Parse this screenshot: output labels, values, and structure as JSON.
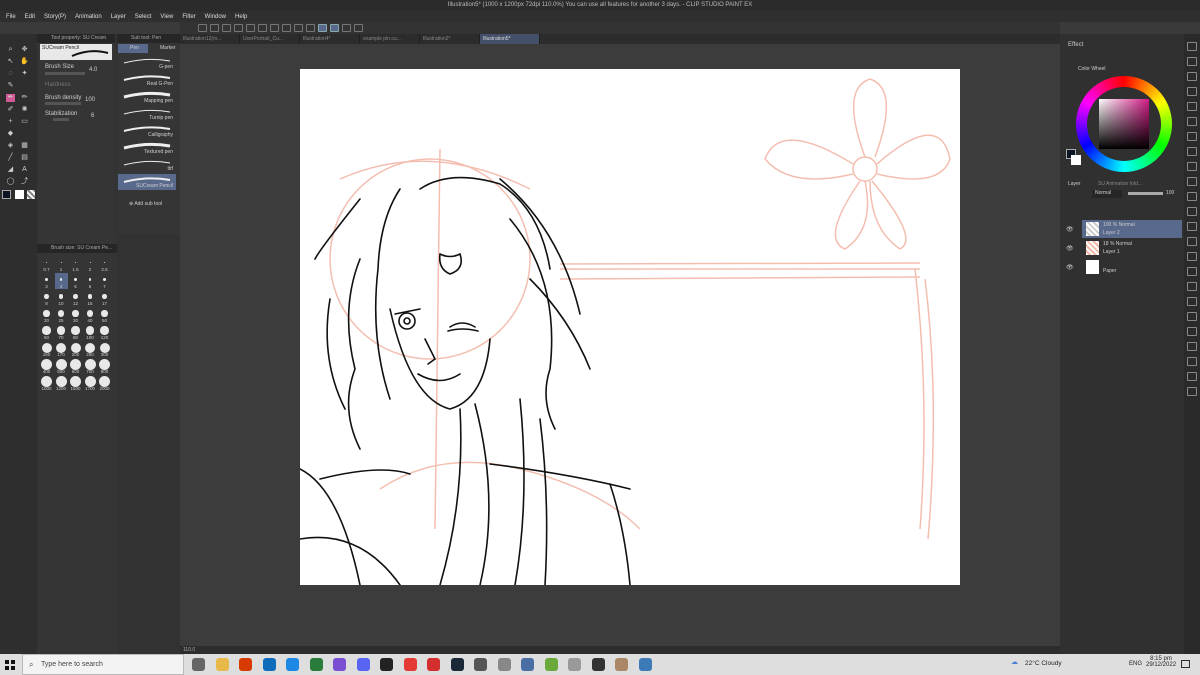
{
  "window": {
    "title": "Illustration5* (1000 x 1200px 72dpi 110.0%)  You can use all features for another 3 days.  - CLIP STUDIO PAINT EX"
  },
  "menu": [
    "File",
    "Edit",
    "Story(P)",
    "Animation",
    "Layer",
    "Select",
    "View",
    "Filter",
    "Window",
    "Help"
  ],
  "doc_tabs": [
    "Illustration12(m...",
    "UserPortrait_Cu...",
    "Illustration4*",
    "example pin.cu...",
    "Illustration2*",
    "Illustration5*"
  ],
  "tool_property": {
    "header": "Tool property: SU Cream Pencil",
    "brush_name": "SUCream Pencil",
    "brush_size_label": "Brush Size",
    "brush_size_value": "4.0",
    "hardness_label": "Hardness",
    "brush_density_label": "Brush density",
    "brush_density_value": "100",
    "stabilization_label": "Stabilization",
    "stabilization_value": "6"
  },
  "subtool": {
    "header": "Sub tool: Pen",
    "tab_pen": "Pen",
    "tab_marker": "Marker",
    "items": [
      "G-pen",
      "Real G-Pen",
      "Mapping pen",
      "Turnip pen",
      "Calligraphy",
      "Textured pen",
      "tttf",
      "SUCream Pencil"
    ],
    "add_label": "Add sub tool"
  },
  "brush_size_panel": {
    "header": "Brush size: SU Cream Pe...",
    "sizes": [
      "0.7",
      "1",
      "1.5",
      "2",
      "2.5",
      "3",
      "4",
      "5",
      "6",
      "7",
      "8",
      "10",
      "12",
      "15",
      "17",
      "20",
      "25",
      "30",
      "40",
      "50",
      "60",
      "70",
      "80",
      "100",
      "120",
      "150",
      "170",
      "200",
      "250",
      "300",
      "400",
      "500",
      "600",
      "700",
      "800",
      "1000",
      "1200",
      "1500",
      "1700",
      "2000"
    ]
  },
  "right": {
    "effect_label": "Effect",
    "color_wheel_label": "Color Wheel",
    "layer_label": "Layer",
    "layer_tab2": "SU Animation fold...",
    "blend_mode": "Normal",
    "opacity": "100",
    "layers": [
      {
        "opacity": "100 % Normal",
        "name": "Layer 2"
      },
      {
        "opacity": "18 % Normal",
        "name": "Layer 1"
      },
      {
        "opacity": "",
        "name": "Paper"
      }
    ]
  },
  "statusbar": {
    "zoom": "110.0"
  },
  "taskbar": {
    "search_placeholder": "Type here to search",
    "weather": "22°C  Cloudy",
    "lang": "ENG",
    "time": "8:15 pm",
    "date": "29/12/2022"
  },
  "colors": {
    "accent": "#58698c",
    "sketch": "#f2b8a8",
    "wheel_hue": "#d21b86"
  }
}
